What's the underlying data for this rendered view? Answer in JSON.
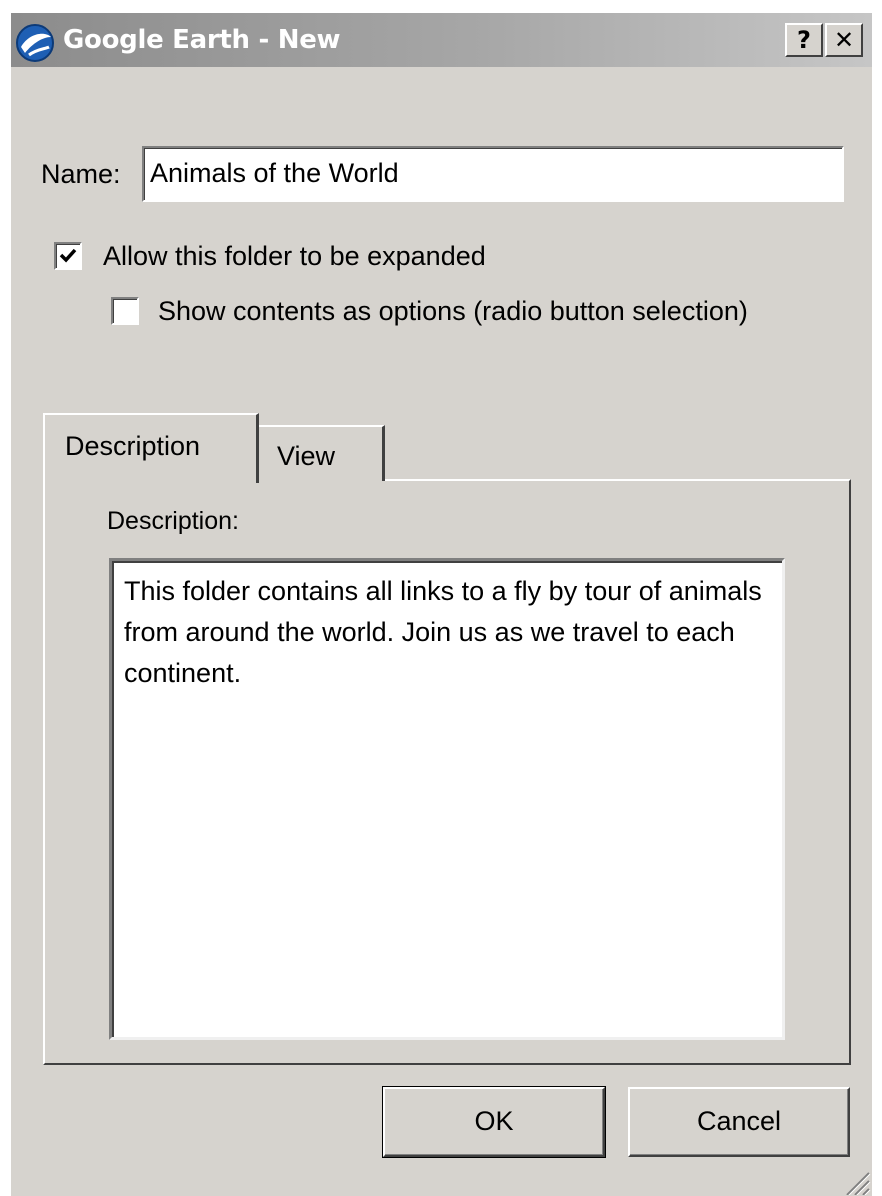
{
  "window": {
    "title": "Google Earth - New",
    "help_label": "?",
    "close_label": "✕"
  },
  "name": {
    "label": "Name:",
    "value": "Animals of the World"
  },
  "options": {
    "expand_label": "Allow this folder to be expanded",
    "expand_checked": true,
    "radio_label": "Show contents as options (radio button selection)",
    "radio_checked": false
  },
  "tabs": [
    {
      "label": "Description",
      "active": true
    },
    {
      "label": "View",
      "active": false
    }
  ],
  "description": {
    "label": "Description:",
    "text": "This folder contains all links to a fly by tour of animals from around the world.  Join us as we travel to each continent."
  },
  "buttons": {
    "ok_label": "OK",
    "cancel_label": "Cancel"
  },
  "colors": {
    "dialog_bg": "#d6d3ce",
    "titlebar": "#a7a7a7"
  }
}
